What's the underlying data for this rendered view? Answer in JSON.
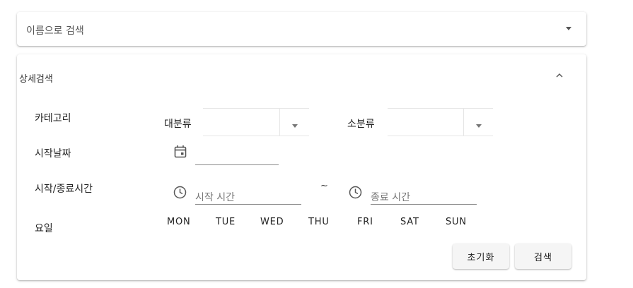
{
  "name_search": {
    "title": "이름으로 검색"
  },
  "detail_search": {
    "title": "상세검색",
    "category": {
      "label": "카테고리",
      "major_label": "대분류",
      "major_value": "",
      "minor_label": "소분류",
      "minor_value": ""
    },
    "start_date": {
      "label": "시작날짜",
      "value": ""
    },
    "time": {
      "label": "시작/종료시간",
      "start_placeholder": "시작 시간",
      "separator": "~",
      "end_placeholder": "종료 시간"
    },
    "weekday": {
      "label": "요일",
      "days": [
        "MON",
        "TUE",
        "WED",
        "THU",
        "FRI",
        "SAT",
        "SUN"
      ]
    },
    "buttons": {
      "reset": "초기화",
      "search": "검색"
    }
  },
  "icons": {
    "name_dropdown": "caret-down-icon",
    "collapse": "chevron-up-icon",
    "date": "calendar-icon",
    "time": "clock-icon"
  }
}
